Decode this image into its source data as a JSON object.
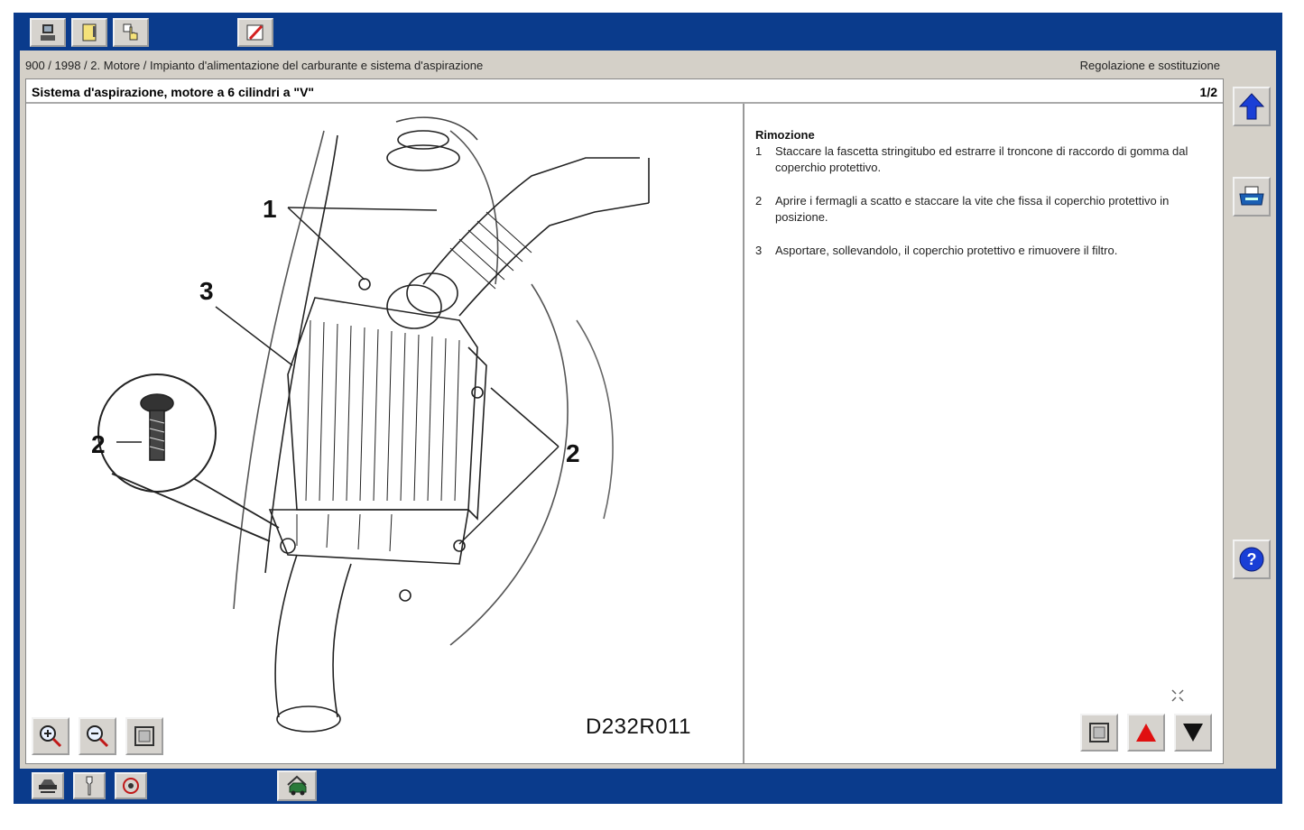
{
  "breadcrumb": "900 / 1998 / 2. Motore / Impianto d'alimentazione del carburante e sistema d'aspirazione",
  "section": "Regolazione e sostituzione",
  "document": {
    "title": "Sistema d'aspirazione, motore a 6 cilindri a \"V\"",
    "page": "1/2"
  },
  "illustration": {
    "code": "D232R011",
    "callouts": [
      "1",
      "2",
      "2",
      "3"
    ]
  },
  "instructions": {
    "heading": "Rimozione",
    "steps": [
      {
        "num": "1",
        "text": "Staccare la fascetta stringitubo ed estrarre il troncone di raccordo di gomma dal coperchio protettivo."
      },
      {
        "num": "2",
        "text": "Aprire i fermagli a scatto e staccare la vite che fissa il coperchio protettivo in posizione."
      },
      {
        "num": "3",
        "text": "Asportare, sollevandolo, il coperchio protettivo e rimuovere il filtro."
      }
    ]
  },
  "colors": {
    "frame": "#0a3b8c",
    "panel": "#d4d0c8",
    "nav_up": "#1a3fd6",
    "nav_red": "#e01010"
  },
  "icons": {
    "top": [
      "computer-icon",
      "document-icon",
      "hand-pointer-icon",
      "edit-pen-icon"
    ],
    "image_tools": [
      "zoom-in-icon",
      "zoom-out-icon",
      "fit-window-icon"
    ],
    "text_nav": [
      "fit-window-icon",
      "previous-page-icon",
      "next-page-icon"
    ],
    "sidebar": [
      "arrow-up-icon",
      "print-icon",
      "help-icon"
    ],
    "bottom": [
      "vehicle-tools-icon",
      "wrench-icon",
      "diagnostic-icon",
      "home-car-icon"
    ]
  }
}
